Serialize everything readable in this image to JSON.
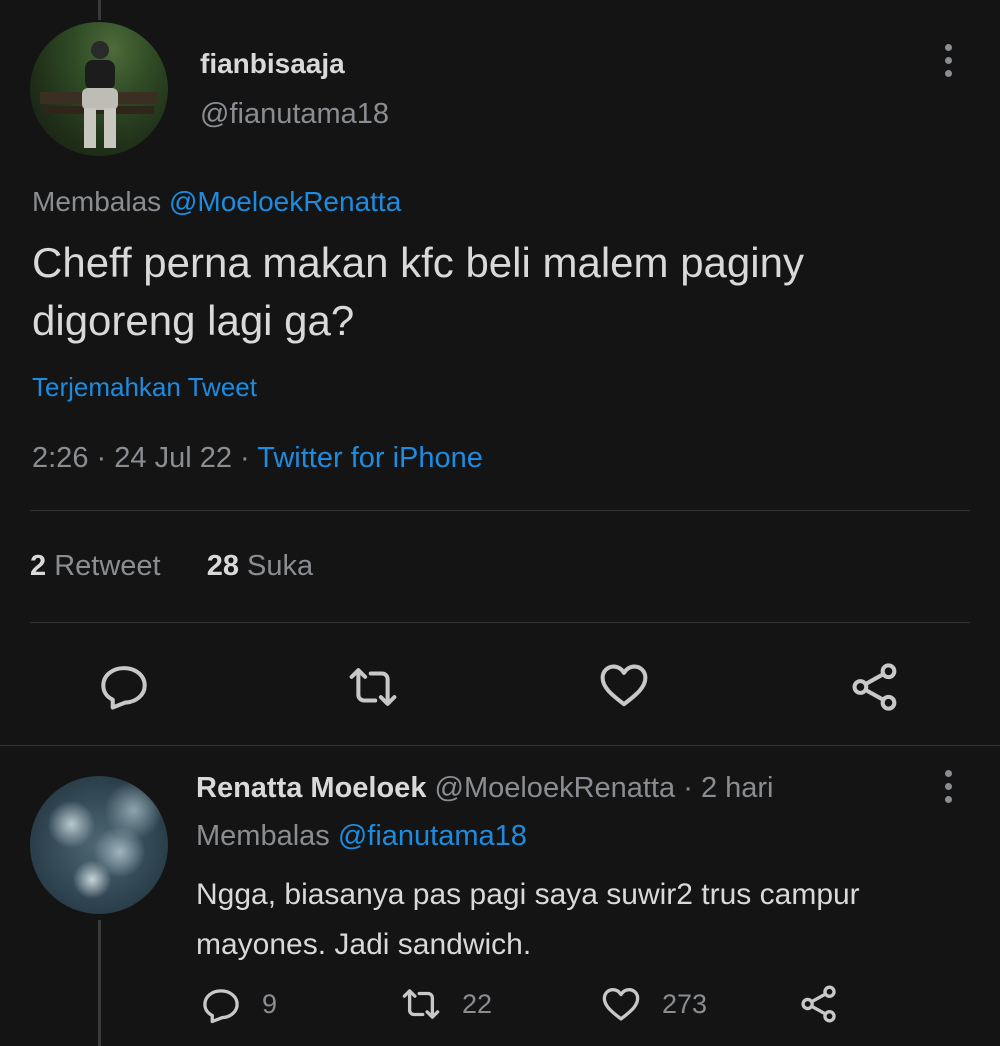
{
  "tweet": {
    "display_name": "fianbisaaja",
    "handle": "@fianutama18",
    "replying_prefix": "Membalas",
    "replying_to": "@MoeloekRenatta",
    "text": "Cheff perna makan kfc beli malem paginy digoreng lagi ga?",
    "translate_label": "Terjemahkan Tweet",
    "time": "2:26",
    "separator": "·",
    "date": "24 Jul 22",
    "source": "Twitter for iPhone",
    "retweet_count": "2",
    "retweet_label": "Retweet",
    "like_count": "28",
    "like_label": "Suka"
  },
  "reply": {
    "display_name": "Renatta Moeloek",
    "handle": "@MoeloekRenatta",
    "separator": "·",
    "age": "2 hari",
    "replying_prefix": "Membalas",
    "replying_to": "@fianutama18",
    "text": "Ngga, biasanya pas pagi saya suwir2 trus campur mayones. Jadi sandwich.",
    "reply_count": "9",
    "retweet_count": "22",
    "like_count": "273"
  },
  "icons": {
    "reply": "reply-icon",
    "retweet": "retweet-icon",
    "like": "heart-icon",
    "share": "share-icon",
    "more": "more-icon"
  },
  "colors": {
    "background": "#141414",
    "link": "#1d8ce0",
    "text": "#d9d9d9",
    "muted": "#8a8d91",
    "divider": "#2f3336"
  }
}
